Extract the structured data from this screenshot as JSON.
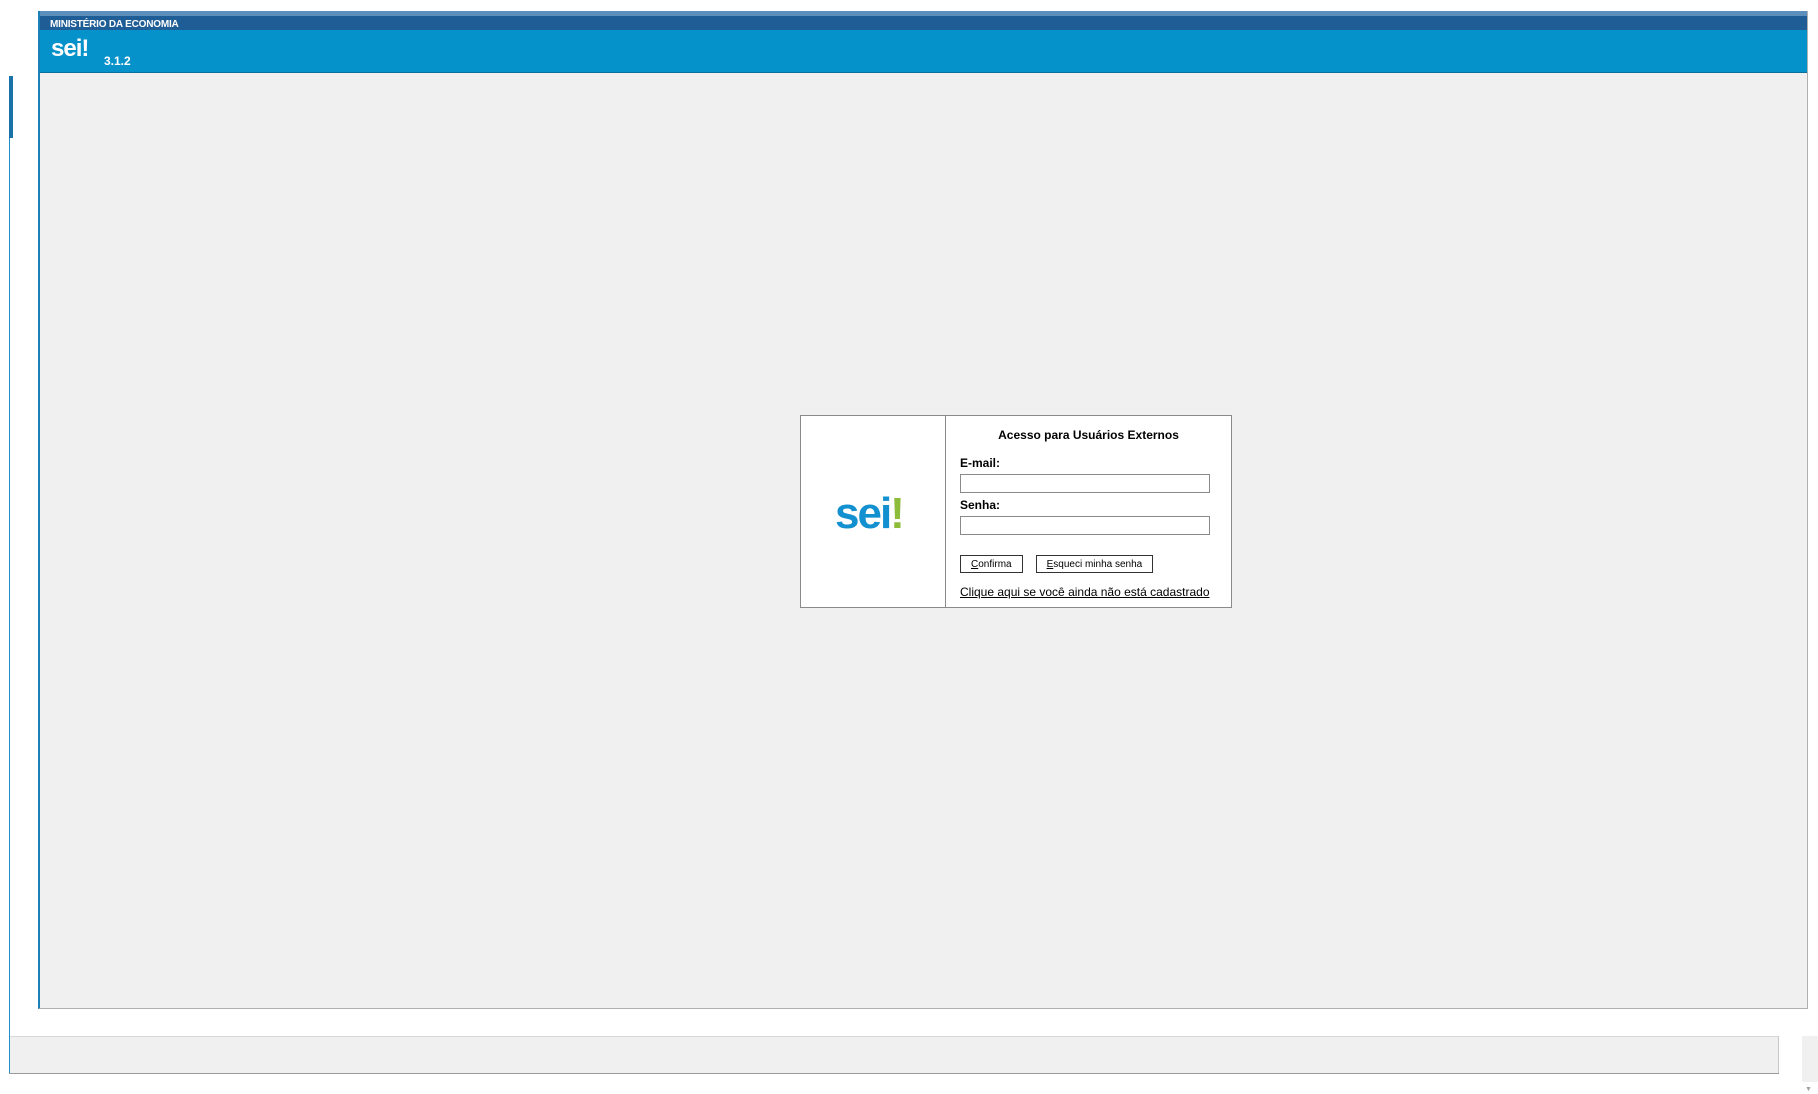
{
  "header": {
    "org_name": "MINISTÉRIO DA ECONOMIA",
    "logo_text": "sei!",
    "version": "3.1.2"
  },
  "login": {
    "logo_text": "sei!",
    "title": "Acesso para Usuários Externos",
    "email_label": "E-mail:",
    "email_value": "",
    "password_label": "Senha:",
    "password_value": "",
    "confirm_button": {
      "accesskey": "C",
      "rest": "onfirma"
    },
    "forgot_button": {
      "accesskey": "E",
      "rest": "squeci minha senha"
    },
    "register_link": "Clique aqui se você ainda não está cadastrado"
  },
  "icons": {
    "scroll_down": "scroll-down-arrow-icon"
  },
  "colors": {
    "org_bar": "#1f5d96",
    "brand_bar": "#0591c9",
    "logo_blue": "#1390d0",
    "logo_green": "#8dbb3a",
    "page_background": "#f0f0f0"
  }
}
